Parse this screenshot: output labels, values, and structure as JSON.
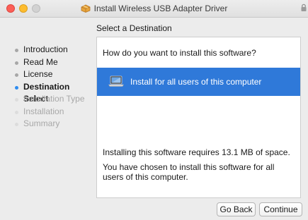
{
  "window": {
    "title": "Install Wireless USB Adapter Driver"
  },
  "header": {
    "subtitle": "Select a Destination"
  },
  "steps": [
    {
      "label": "Introduction",
      "state": "done"
    },
    {
      "label": "Read Me",
      "state": "done"
    },
    {
      "label": "License",
      "state": "done"
    },
    {
      "label": "Destination Select",
      "state": "active"
    },
    {
      "label": "Installation Type",
      "state": "future"
    },
    {
      "label": "Installation",
      "state": "future"
    },
    {
      "label": "Summary",
      "state": "future"
    }
  ],
  "main": {
    "question": "How do you want to install this software?",
    "option_label": "Install for all users of this computer",
    "space_info": "Installing this software requires 13.1 MB of space.",
    "choice_info": "You have chosen to install this software for all users of this computer."
  },
  "buttons": {
    "back": "Go Back",
    "continue": "Continue"
  },
  "colors": {
    "selection": "#2f79d9",
    "active_step_dot": "#2e8cf0"
  },
  "icons": {
    "title_icon": "package-icon",
    "option_icon": "laptop-icon",
    "corner_icon": "lock-icon"
  }
}
